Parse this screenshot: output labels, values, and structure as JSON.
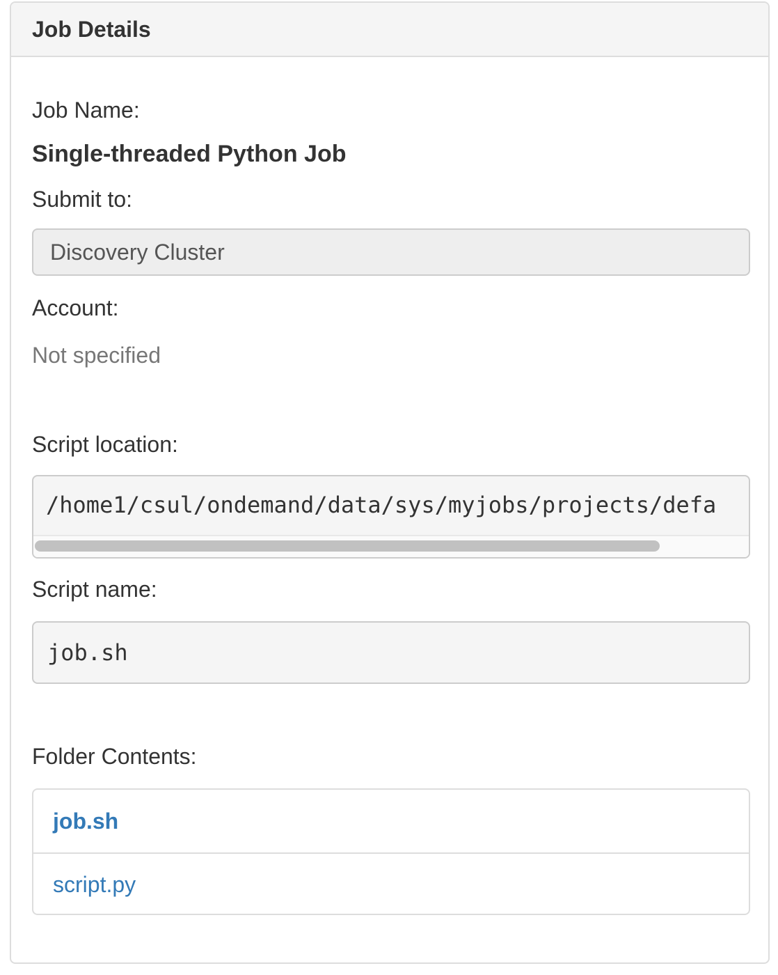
{
  "panel": {
    "title": "Job Details"
  },
  "job_name": {
    "label": "Job Name:",
    "value": "Single-threaded Python Job"
  },
  "submit_to": {
    "label": "Submit to:",
    "value": "Discovery Cluster"
  },
  "account": {
    "label": "Account:",
    "value": "Not specified"
  },
  "script_location": {
    "label": "Script location:",
    "value": "/home1/csul/ondemand/data/sys/myjobs/projects/defa"
  },
  "script_name": {
    "label": "Script name:",
    "value": "job.sh"
  },
  "folder_contents": {
    "label": "Folder Contents:",
    "items": [
      {
        "name": "job.sh",
        "selected": true
      },
      {
        "name": "script.py",
        "selected": false
      }
    ]
  },
  "colors": {
    "link": "#337ab7",
    "heading_bg": "#f5f5f5",
    "muted": "#777777"
  }
}
